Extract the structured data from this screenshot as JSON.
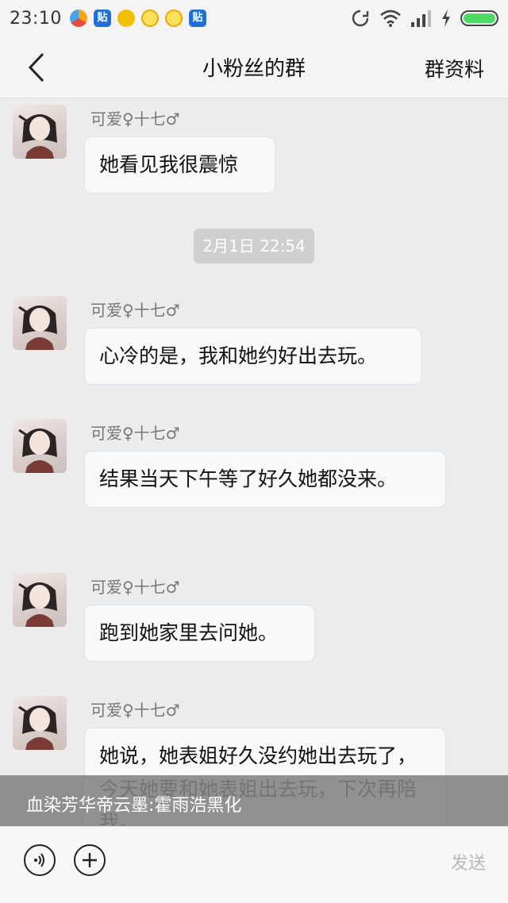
{
  "status_bar": {
    "time": "23:10",
    "notif_badge": "贴"
  },
  "nav": {
    "title": "小粉丝的群",
    "right_action": "群资料"
  },
  "messages": [
    {
      "sender": "可爱♀十七♂",
      "text": "她看见我很震惊"
    },
    {
      "sender": "可爱♀十七♂",
      "text": "心冷的是，我和她约好出去玩。"
    },
    {
      "sender": "可爱♀十七♂",
      "text": "结果当天下午等了好久她都没来。"
    },
    {
      "sender": "可爱♀十七♂",
      "text": "跑到她家里去问她。"
    },
    {
      "sender": "可爱♀十七♂",
      "text": "她说，她表姐好久没约她出去玩了，今天她要和她表姐出去玩，下次再陪我。"
    }
  ],
  "timestamp": "2月1日 22:54",
  "overlay_caption": "血染芳华帝云墨:霍雨浩黑化",
  "input_bar": {
    "send_label": "发送"
  },
  "colors": {
    "battery": "#4cd964",
    "bubble_bg": "#f7f9fb",
    "timestamp_bg": "#cfcfcf"
  }
}
